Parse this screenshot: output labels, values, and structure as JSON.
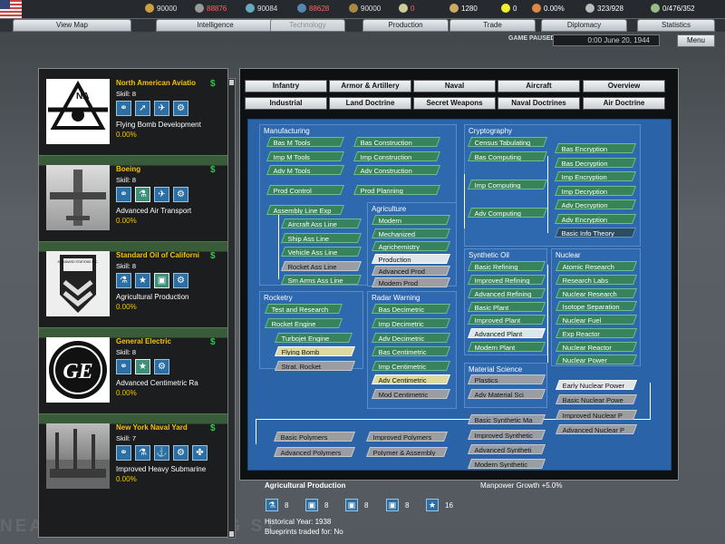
{
  "background": {
    "watermark": "NEAREST RECRUITING ST"
  },
  "resources": [
    {
      "icon": "energy-icon",
      "value": "90000",
      "color": "#e0e0e0"
    },
    {
      "icon": "metal-icon",
      "value": "88876",
      "color": "#ff6060"
    },
    {
      "icon": "rares-icon",
      "value": "90084",
      "color": "#e0e0e0"
    },
    {
      "icon": "oil-icon",
      "value": "88628",
      "color": "#ff6060"
    },
    {
      "icon": "supplies-icon",
      "value": "90000",
      "color": "#e0e0e0"
    },
    {
      "icon": "money-icon",
      "value": "0",
      "color": "#ff6060"
    },
    {
      "icon": "transport-icon",
      "value": "1280",
      "color": "#e0e0e0"
    },
    {
      "icon": "nuke-icon",
      "value": "0",
      "color": "#e0e0e0"
    },
    {
      "icon": "dissent-icon",
      "value": "0.00%",
      "color": "#e0e0e0"
    },
    {
      "icon": "manpower-icon",
      "value": "323/928",
      "color": "#e0e0e0"
    },
    {
      "icon": "ic-icon",
      "value": "0/476/352",
      "color": "#e0e0e0"
    }
  ],
  "tabs": [
    "View Map",
    "Intelligence",
    "Technology",
    "Production",
    "Trade",
    "Diplomacy",
    "Statistics"
  ],
  "status": {
    "paused": "GAME PAUSED",
    "date": "0:00 June 20, 1944",
    "menu": "Menu"
  },
  "teams": [
    {
      "name": "North American Aviatio",
      "skill": "Skill: 8",
      "researching": "Flying Bomb Development",
      "progress": "0.00%",
      "icons": [
        "bulb",
        "missile",
        "jet",
        "gears"
      ]
    },
    {
      "name": "Boeing",
      "skill": "Skill: 8",
      "researching": "Advanced Air Transport",
      "progress": "0.00%",
      "icons": [
        "bulb",
        "flask",
        "jet",
        "gears"
      ]
    },
    {
      "name": "Standard Oil of Californi",
      "skill": "Skill: 8",
      "researching": "Agricultural Production",
      "progress": "0.00%",
      "icons": [
        "flask",
        "star",
        "factory",
        "gears"
      ]
    },
    {
      "name": "General Electric",
      "skill": "Skill: 8",
      "researching": "Advanced Centimetric Ra",
      "progress": "0.00%",
      "icons": [
        "bulb",
        "star",
        "gears"
      ]
    },
    {
      "name": "New York Naval Yard",
      "skill": "Skill: 7",
      "researching": "Improved Heavy Submarine",
      "progress": "0.00%",
      "icons": [
        "bulb",
        "flask",
        "anchor",
        "gears",
        "propeller"
      ]
    }
  ],
  "logos": {
    "naa": "NA",
    "standard": "STANDARD STATIONS INC.",
    "ge": "GE"
  },
  "categories": {
    "row1": [
      "Infantry",
      "Armor & Artillery",
      "Naval",
      "Aircraft",
      "Overview"
    ],
    "row2": [
      "Industrial",
      "Land Doctrine",
      "Secret Weapons",
      "Naval Doctrines",
      "Air Doctrine"
    ]
  },
  "groups": {
    "manufacturing": "Manufacturing",
    "agriculture": "Agriculture",
    "rocketry": "Rocketry",
    "radar": "Radar Warning",
    "cryptography": "Cryptography",
    "synthetic": "Synthetic Oil",
    "nuclear": "Nuclear",
    "material": "Material Science"
  },
  "techs": {
    "manufacturing": [
      "Bas M Tools",
      "Bas Construction",
      "Imp M Tools",
      "Imp Construction",
      "Adv M Tools",
      "Adv Construction",
      "Prod Control",
      "Prod Planning",
      "Assembly Line Exp",
      "Aircraft Ass Line",
      "Ship Ass Line",
      "Vehicle Ass Line",
      "Rocket Ass Line",
      "Sm Arms Ass Line"
    ],
    "agriculture": [
      "Modern",
      "Mechanized",
      "Agrichemistry",
      "Production",
      "Advanced Prod",
      "Modern Prod"
    ],
    "rocketry": [
      "Test and Research",
      "Rocket Engine",
      "Turbojet Engine",
      "Flying Bomb",
      "Strat. Rocket"
    ],
    "radar": [
      "Bas Decimetric",
      "Imp Decimetric",
      "Adv Decimetric",
      "Bas Centimetric",
      "Imp Centimetric",
      "Adv Centimetric",
      "Mod Centimetric"
    ],
    "cryptography": [
      "Census Tabulating",
      "Bas Computing",
      "Bas Encryption",
      "Bas Decryption",
      "Imp Computing",
      "Imp Encryption",
      "Imp Decryption",
      "Adv Computing",
      "Adv Decryption",
      "Adv Encryption",
      "Basic Info Theory"
    ],
    "synthetic": [
      "Basic Refining",
      "Improved Refining",
      "Advanced Refining",
      "Basic Plant",
      "Improved Plant",
      "Advanced Plant",
      "Modern Plant"
    ],
    "nuclear": [
      "Atomic Research",
      "Research Labs",
      "Nuclear Research",
      "Isotope Separation",
      "Nuclear Fuel",
      "Exp Reactor",
      "Nuclear Reactor",
      "Nuclear Power",
      "Early Nuclear Power",
      "Basic Nuclear Powe",
      "Improved Nuclear P",
      "Advanced Nuclear P"
    ],
    "material": [
      "Plastics",
      "Adv Material Sci",
      "Basic Synthetic Ma",
      "Improved Synthetic",
      "Advanced Syntheti",
      "Modern Synthetic"
    ],
    "polymers": [
      "Basic Polymers",
      "Improved Polymers",
      "Advanced Polymers",
      "Polymer & Assembly"
    ]
  },
  "selected": {
    "title": "Agricultural Production",
    "effect": "Manpower Growth +5.0%",
    "requirements": [
      {
        "icon": "flask",
        "value": "8"
      },
      {
        "icon": "factory",
        "value": "8"
      },
      {
        "icon": "factory",
        "value": "8"
      },
      {
        "icon": "factory",
        "value": "8"
      },
      {
        "icon": "star",
        "value": "16"
      }
    ],
    "historical": "Historical Year: 1938",
    "blueprints": "Blueprints traded for: No"
  }
}
